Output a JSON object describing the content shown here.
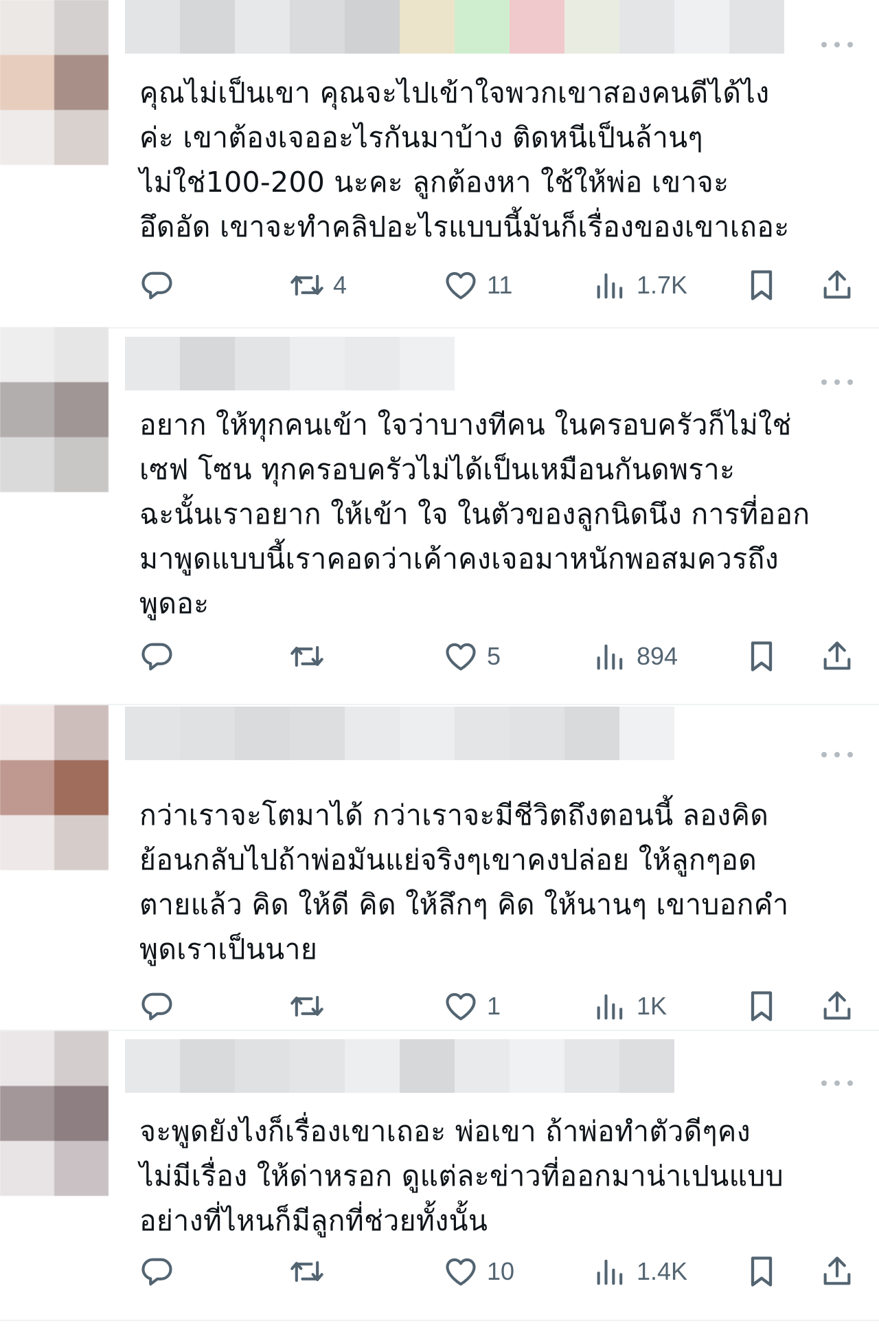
{
  "posts": [
    {
      "text": "คุณไม่เป็นเขา คุณจะไปเข้าใจพวกเขาสองคนดีได้ไง\nค่ะ เขาต้องเจออะไรกันมาบ้าง ติดหนีเป็นล้านๆ\nไม่ใช่100-200 นะคะ ลูกต้องหา ใช้ให้พ่อ เขาจะ\nอึดอัด เขาจะทำคลิปอะไรแบบนี้มันก็เรื่องของเขาเถอะ",
      "retweets": "4",
      "likes": "11",
      "views": "1.7K"
    },
    {
      "text": "อยาก ให้ทุกคนเข้า ใจว่าบางทีคน ในครอบครัวก็ไม่ใช่\nเซฟ โซน ทุกครอบครัวไม่ได้เป็นเหมือนกันดพราะ\nฉะนั้นเราอยาก ให้เข้า ใจ ในตัวของลูกนิดนึง การที่ออก\nมาพูดแบบนี้เราคอดว่าเค้าคงเจอมาหนักพอสมควรถึง\nพูดอะ",
      "retweets": "",
      "likes": "5",
      "views": "894"
    },
    {
      "text": "กว่าเราจะโตมาได้ กว่าเราจะมีชีวิตถึงตอนนี้ ลองคิด\nย้อนกลับไปถ้าพ่อมันแย่จริงๆเขาคงปล่อย ให้ลูกๆอด\nตายแล้ว คิด ให้ดี คิด ให้ลึกๆ คิด ให้นานๆ เขาบอกคำ\nพูดเราเป็นนาย",
      "retweets": "",
      "likes": "1",
      "views": "1K"
    },
    {
      "text": "จะพูดยังไงก็เรื่องเขาเถอะ พ่อเขา ถ้าพ่อทำตัวดีๆคง\nไม่มีเรื่อง ให้ด่าหรอก ดูแต่ละข่าวที่ออกมาน่าเปนแบบ\nอย่างที่ไหนก็มีลูกที่ช่วยทั้งนั้น",
      "retweets": "",
      "likes": "10",
      "views": "1.4K"
    }
  ],
  "icons": {
    "reply": "reply-icon",
    "retweet": "retweet-icon",
    "like": "heart-icon",
    "views": "views-icon",
    "bookmark": "bookmark-icon",
    "share": "share-icon",
    "more": "more-icon"
  },
  "colors": {
    "text": "#0f1419",
    "muted": "#536471",
    "divider": "#eff3f4"
  }
}
